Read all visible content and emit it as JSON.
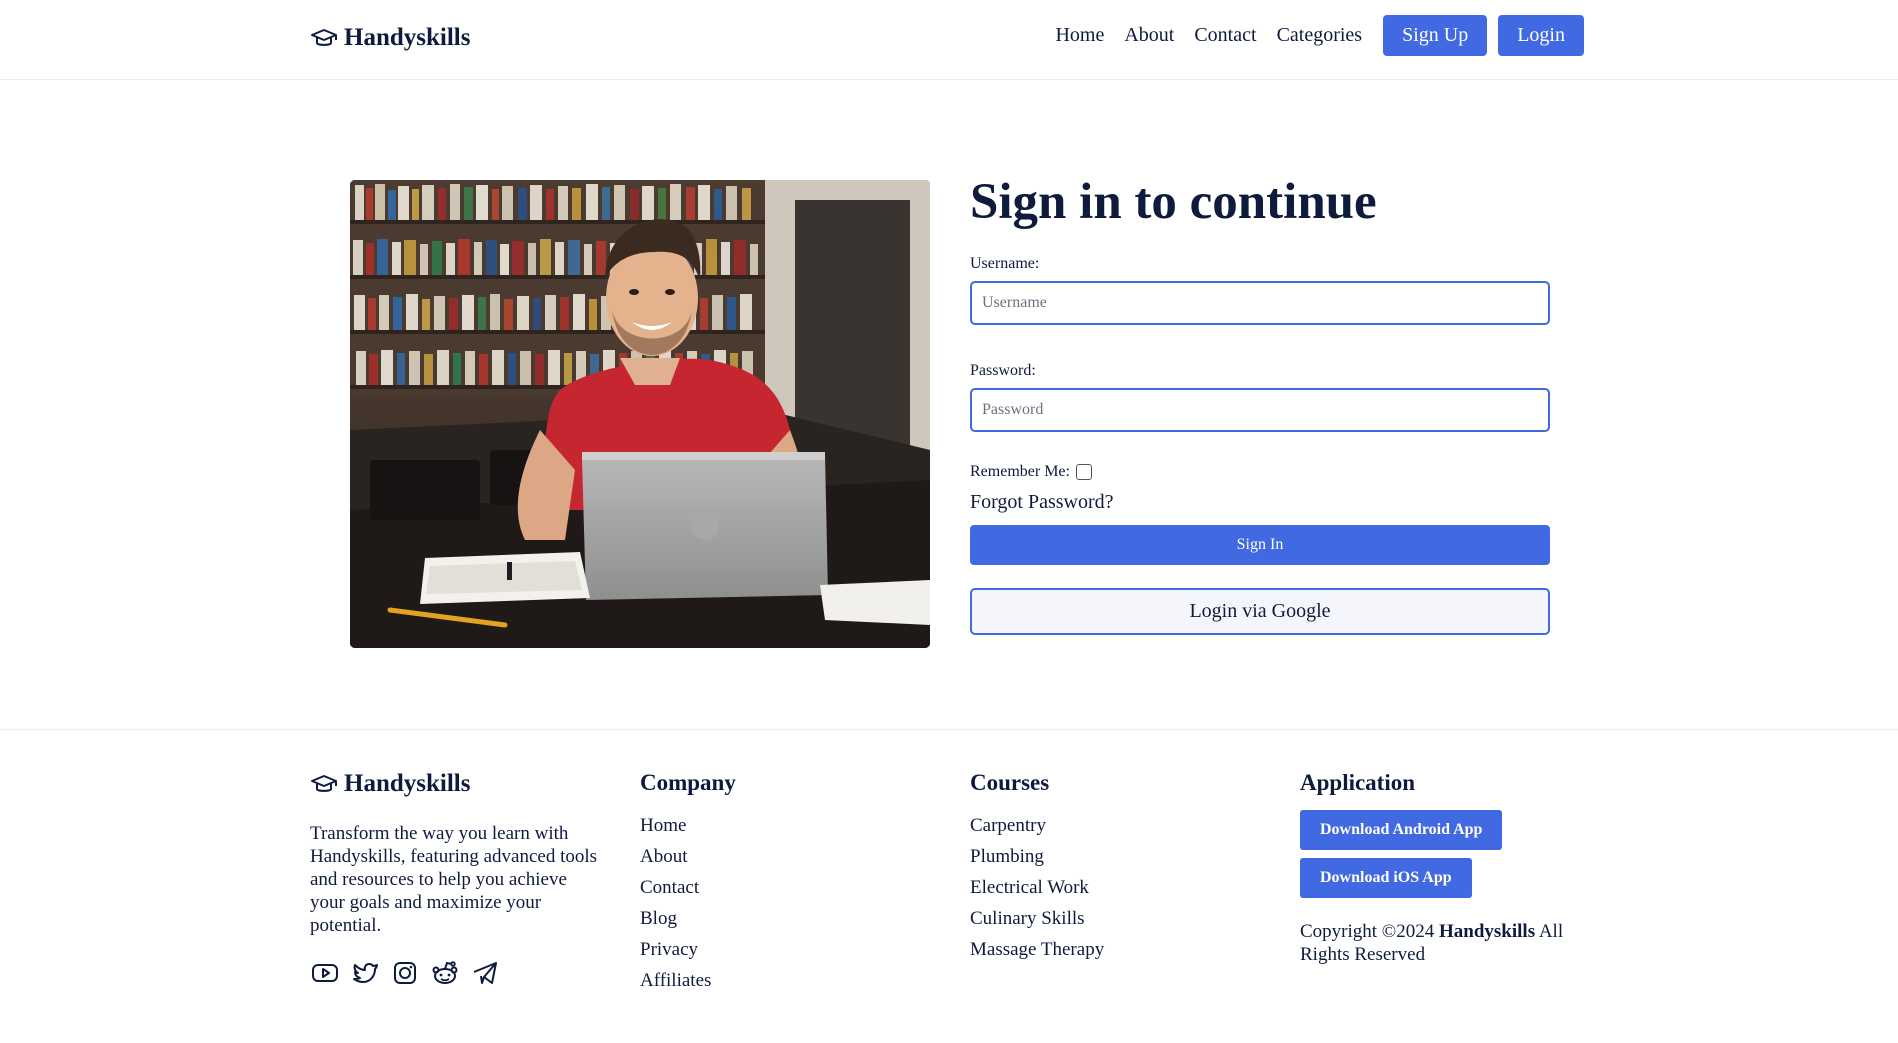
{
  "header": {
    "brand": "Handyskills",
    "brand_icon": "graduation-cap-icon",
    "nav": [
      "Home",
      "About",
      "Contact",
      "Categories"
    ],
    "signup_label": "Sign Up",
    "login_label": "Login"
  },
  "hero_image": "student-with-laptop-in-library-photo",
  "form": {
    "title": "Sign in to continue",
    "username_label": "Username:",
    "username_placeholder": "Username",
    "username_value": "",
    "password_label": "Password:",
    "password_placeholder": "Password",
    "password_value": "",
    "remember_label": "Remember Me:",
    "remember_checked": false,
    "forgot_label": "Forgot Password?",
    "signin_label": "Sign In",
    "google_label": "Login via Google"
  },
  "footer": {
    "brand": "Handyskills",
    "description": "Transform the way you learn with Handyskills, featuring advanced tools and resources to help you achieve your goals and maximize your potential.",
    "socials": [
      "youtube-icon",
      "twitter-icon",
      "instagram-icon",
      "reddit-icon",
      "telegram-icon"
    ],
    "company": {
      "title": "Company",
      "links": [
        "Home",
        "About",
        "Contact",
        "Blog",
        "Privacy",
        "Affiliates"
      ]
    },
    "courses": {
      "title": "Courses",
      "links": [
        "Carpentry",
        "Plumbing",
        "Electrical Work",
        "Culinary Skills",
        "Massage Therapy"
      ]
    },
    "application": {
      "title": "Application",
      "android_label": "Download Android App",
      "ios_label": "Download iOS App",
      "copyright_prefix": "Copyright ©2024",
      "copyright_brand": "Handyskills",
      "copyright_suffix": "All Rights Reserved"
    }
  },
  "colors": {
    "accent": "#4169e1",
    "text": "#0f1b3d"
  }
}
